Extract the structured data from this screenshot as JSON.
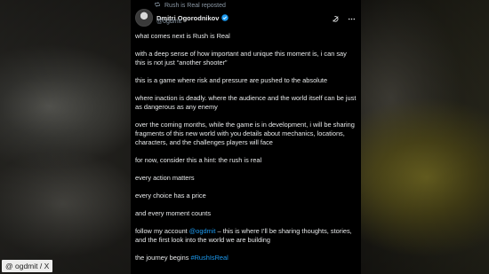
{
  "repost": {
    "text": "Rush is Real reposted",
    "icon": "repost-icon"
  },
  "author": {
    "name": "Dmitri Ogorodnikov",
    "handle": "@ogdmit",
    "verified_color": "#1d9bf0"
  },
  "header_icons": [
    "grok-icon",
    "more-icon"
  ],
  "post": {
    "p1": "what comes next is Rush is Real",
    "p2": "with a deep sense of how important and unique this moment is, i can say this is not just “another shooter”",
    "p3": "this is a game where risk and pressure are pushed to the absolute",
    "p4": "where inaction is deadly. where the audience and the world itself can be just as dangerous as any enemy",
    "p5": "over the coming months, while the game is in development, i will be sharing fragments of this new world with you details about mechanics, locations, characters, and the challenges players will face",
    "p6": "for now, consider this a hint: the rush is real",
    "p7": "every action matters",
    "p8": "every choice has a price",
    "p9": "and every moment counts",
    "p10_a": "follow my account ",
    "p10_link": "@ogdmit",
    "p10_b": " – this is where I’ll be sharing thoughts, stories, and the first look into the world we are building",
    "p11_a": "the journey begins ",
    "p11_hashtag": "#RushIsReal"
  },
  "credit": "@ ogdmit / X",
  "colors": {
    "link": "#1d9bf0",
    "card_bg": "#000000",
    "muted": "#8b98a5"
  }
}
